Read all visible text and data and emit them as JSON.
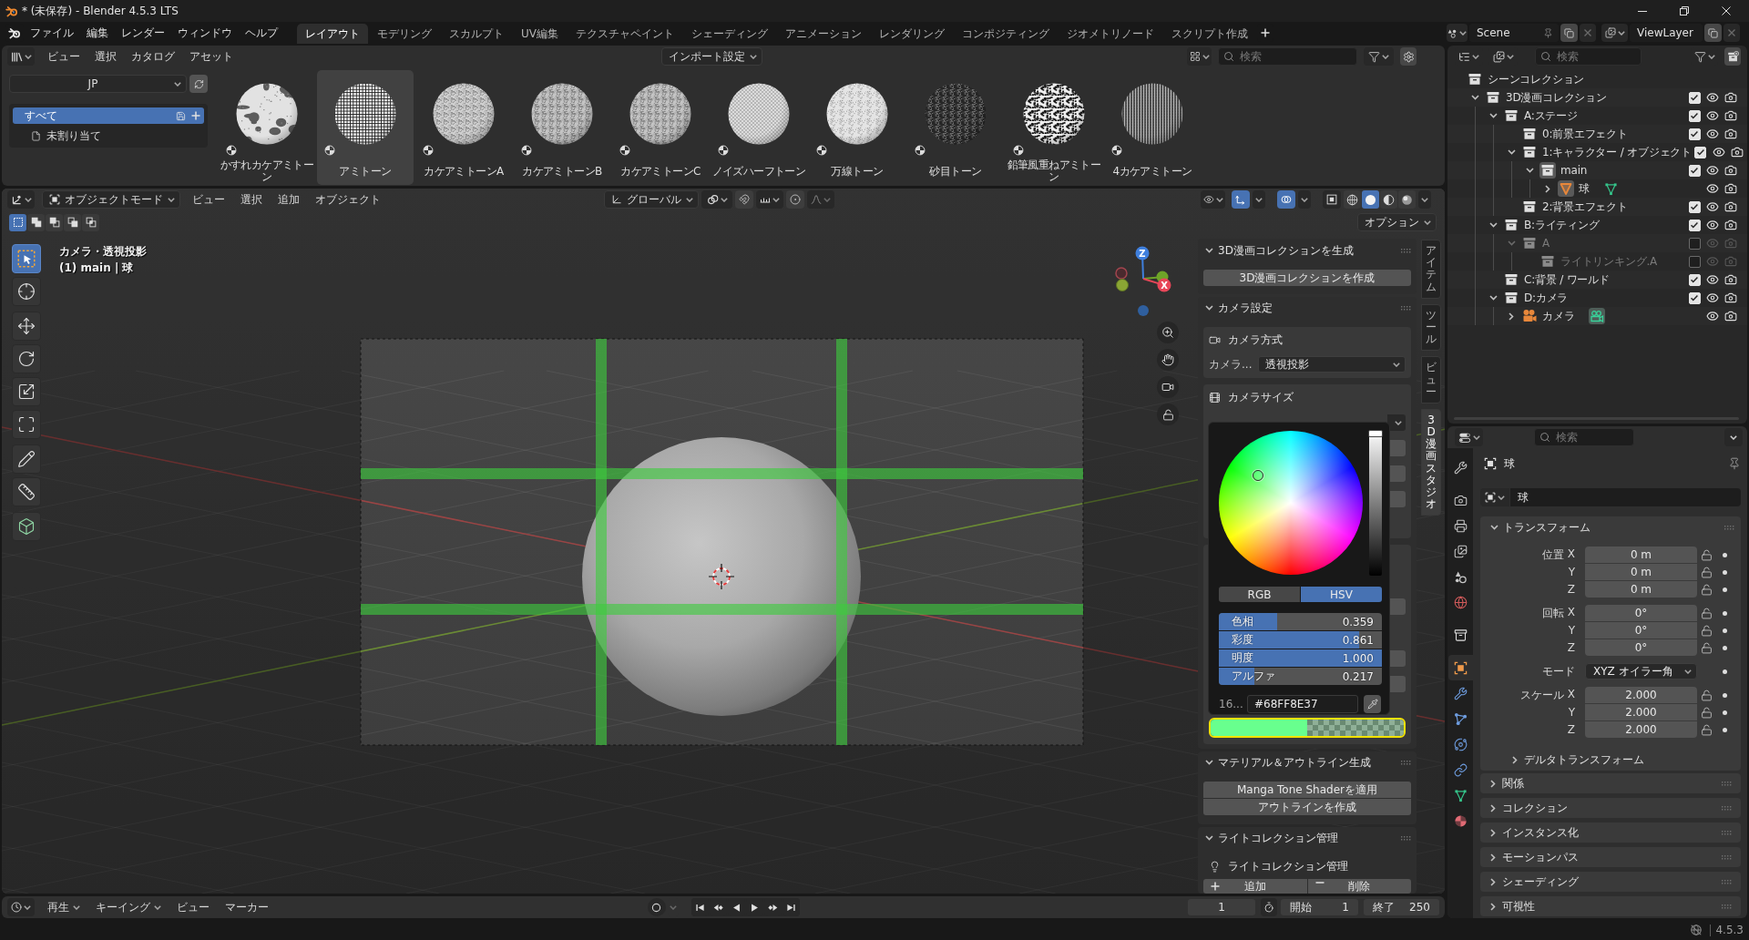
{
  "window": {
    "title": "* (未保存) - Blender 4.5.3 LTS"
  },
  "topbar": {
    "menus": [
      "ファイル",
      "編集",
      "レンダー",
      "ウィンドウ",
      "ヘルプ"
    ],
    "workspaces": [
      {
        "label": "レイアウト",
        "selected": true
      },
      {
        "label": "モデリング",
        "selected": false
      },
      {
        "label": "スカルプト",
        "selected": false
      },
      {
        "label": "UV編集",
        "selected": false
      },
      {
        "label": "テクスチャペイント",
        "selected": false
      },
      {
        "label": "シェーディング",
        "selected": false
      },
      {
        "label": "アニメーション",
        "selected": false
      },
      {
        "label": "レンダリング",
        "selected": false
      },
      {
        "label": "コンポジティング",
        "selected": false
      },
      {
        "label": "ジオメトリノード",
        "selected": false
      },
      {
        "label": "スクリプト作成",
        "selected": false
      }
    ],
    "scene": "Scene",
    "view_layer": "ViewLayer"
  },
  "asset_browser": {
    "menus": [
      "ビュー",
      "選択",
      "カタログ",
      "アセット"
    ],
    "import_setting": "インポート設定",
    "search": {
      "placeholder": "検索"
    },
    "library": "JP",
    "catalogs": [
      {
        "label": "すべて",
        "kind": "all",
        "selected": true
      },
      {
        "label": "未割り当て",
        "kind": "unassigned",
        "selected": false
      }
    ],
    "assets": [
      {
        "name": "かすれカケアミトーン",
        "kind": "blotch",
        "selected": false
      },
      {
        "name": "アミトーン",
        "kind": "grid",
        "selected": true
      },
      {
        "name": "カケアミトーンA",
        "kind": "crosshatch",
        "selected": false
      },
      {
        "name": "カケアミトーンB",
        "kind": "noise",
        "selected": false
      },
      {
        "name": "カケアミトーンC",
        "kind": "noise",
        "selected": false
      },
      {
        "name": "ノイズハーフトーン",
        "kind": "diagonal",
        "selected": false
      },
      {
        "name": "万線トーン",
        "kind": "speckle",
        "selected": false
      },
      {
        "name": "砂目トーン",
        "kind": "dark",
        "selected": false
      },
      {
        "name": "鉛筆風重ねアミトーン",
        "kind": "mottled",
        "selected": false
      },
      {
        "name": "4カケアミトーン",
        "kind": "stripes",
        "selected": false
      }
    ]
  },
  "viewport": {
    "mode": "オブジェクトモード",
    "menus": [
      "ビュー",
      "選択",
      "追加",
      "オブジェクト"
    ],
    "orientation": "グローバル",
    "shading": [
      {
        "kind": "wireframe",
        "selected": false
      },
      {
        "kind": "solid",
        "selected": true
      },
      {
        "kind": "material",
        "selected": false
      },
      {
        "kind": "rendered",
        "selected": false
      }
    ],
    "select_modes": [
      {
        "kind": "set",
        "selected": true
      },
      {
        "kind": "extend",
        "selected": false
      },
      {
        "kind": "subtract",
        "selected": false
      },
      {
        "kind": "invert",
        "selected": false
      },
      {
        "kind": "intersect",
        "selected": false
      }
    ],
    "options": "オプション",
    "overlay_text": {
      "view": "カメラ・透視投影",
      "object": "(1) main | 球"
    },
    "tool_groups": [
      [
        {
          "kind": "select_box",
          "selected": true
        },
        {
          "kind": "cursor",
          "selected": false
        }
      ],
      [
        {
          "kind": "move",
          "selected": false
        },
        {
          "kind": "rotate",
          "selected": false
        },
        {
          "kind": "scale",
          "selected": false
        },
        {
          "kind": "transform",
          "selected": false
        }
      ],
      [
        {
          "kind": "annotate",
          "selected": false
        },
        {
          "kind": "measure",
          "selected": false
        }
      ],
      [
        {
          "kind": "add_cube",
          "selected": false
        }
      ]
    ],
    "gizmo": {
      "z_label": "Z",
      "x_label": "X"
    },
    "sidebar": {
      "tabs": [
        {
          "label": "アイテム",
          "selected": false
        },
        {
          "label": "ツール",
          "selected": false
        },
        {
          "label": "ビュー",
          "selected": false
        },
        {
          "label": "3D漫画スタジオ",
          "selected": true
        }
      ],
      "generate_panel": {
        "title": "3D漫画コレクションを生成",
        "expanded": true,
        "button": "3D漫画コレクションを作成"
      },
      "camera_panel": {
        "title": "カメラ設定",
        "expanded": true,
        "method": {
          "title": "カメラ方式",
          "label": "カメラ...",
          "value": "透視投影"
        },
        "size": {
          "title": "カメラサイズ"
        }
      },
      "color_picker": {
        "modes": [
          {
            "label": "RGB",
            "selected": false
          },
          {
            "label": "HSV",
            "selected": true
          }
        ],
        "sliders": [
          {
            "label": "色相",
            "value": "0.359",
            "level": 0.359
          },
          {
            "label": "彩度",
            "value": "0.861",
            "level": 0.861
          },
          {
            "label": "明度",
            "value": "1.000",
            "level": 1.0
          },
          {
            "label": "アルファ",
            "value": "0.217",
            "level": 0.217
          }
        ],
        "hex_label": "16...",
        "hex": "#68FF8E37"
      },
      "color_swatch": {
        "active": true
      },
      "material_panel": {
        "title": "マテリアル＆アウトライン生成",
        "expanded": true,
        "buttons": [
          "Manga Tone Shaderを適用",
          "アウトラインを作成"
        ]
      },
      "light_panel": {
        "title": "ライトコレクション管理",
        "expanded": true,
        "subtitle": "ライトコレクション管理",
        "add": "追加",
        "remove": "削除"
      }
    }
  },
  "outliner": {
    "search": {
      "placeholder": "検索"
    },
    "tree": [
      {
        "label": "シーンコレクション",
        "kind": "scene_collection",
        "active": false,
        "disabled": false,
        "children": [
          {
            "label": "3D漫画コレクション",
            "kind": "collection",
            "expanded": true,
            "checked": true,
            "active": false,
            "disabled": false,
            "children": [
              {
                "label": "A:ステージ",
                "kind": "collection",
                "expanded": true,
                "checked": true,
                "active": false,
                "disabled": false,
                "children": [
                  {
                    "label": "0:前景エフェクト",
                    "kind": "collection",
                    "checked": true,
                    "active": false,
                    "disabled": false
                  },
                  {
                    "label": "1:キャラクター / オブジェクト",
                    "kind": "collection",
                    "expanded": true,
                    "checked": true,
                    "active": false,
                    "disabled": false,
                    "children": [
                      {
                        "label": "main",
                        "kind": "collection",
                        "expanded": true,
                        "checked": true,
                        "active": true,
                        "disabled": false,
                        "children": [
                          {
                            "label": "球",
                            "kind": "mesh_object",
                            "expanded": false,
                            "active": true,
                            "disabled": false
                          }
                        ]
                      }
                    ]
                  },
                  {
                    "label": "2:背景エフェクト",
                    "kind": "collection",
                    "checked": true,
                    "active": false,
                    "disabled": false
                  }
                ]
              },
              {
                "label": "B:ライティング",
                "kind": "collection",
                "expanded": true,
                "checked": true,
                "active": false,
                "disabled": false,
                "children": [
                  {
                    "label": "A",
                    "kind": "collection",
                    "expanded": true,
                    "checked": false,
                    "active": false,
                    "disabled": true,
                    "children": [
                      {
                        "label": "ライトリンキング.A",
                        "kind": "collection",
                        "checked": false,
                        "active": false,
                        "disabled": true
                      }
                    ]
                  }
                ]
              },
              {
                "label": "C:背景 / ワールド",
                "kind": "collection",
                "checked": true,
                "active": false,
                "disabled": false
              },
              {
                "label": "D:カメラ",
                "kind": "collection",
                "expanded": true,
                "checked": true,
                "active": false,
                "disabled": false,
                "children": [
                  {
                    "label": "カメラ",
                    "kind": "camera_object",
                    "expanded": false,
                    "active": false,
                    "disabled": false
                  }
                ]
              }
            ]
          }
        ]
      }
    ]
  },
  "properties": {
    "search": {
      "placeholder": "検索"
    },
    "tab_groups": [
      [
        {
          "kind": "tool",
          "selected": false
        }
      ],
      [
        {
          "kind": "render",
          "selected": false
        },
        {
          "kind": "output",
          "selected": false
        },
        {
          "kind": "view_layer",
          "selected": false
        },
        {
          "kind": "scene",
          "selected": false
        },
        {
          "kind": "world",
          "selected": false
        }
      ],
      [
        {
          "kind": "collection",
          "selected": false
        }
      ],
      [
        {
          "kind": "object",
          "selected": true
        },
        {
          "kind": "modifiers",
          "selected": false
        },
        {
          "kind": "particles",
          "selected": false
        },
        {
          "kind": "physics",
          "selected": false
        },
        {
          "kind": "constraints",
          "selected": false
        },
        {
          "kind": "data",
          "selected": false
        },
        {
          "kind": "material",
          "selected": false
        }
      ]
    ],
    "object_name": "球",
    "name_field": "球",
    "transform": {
      "title": "トランスフォーム",
      "expanded": true,
      "fields": [
        {
          "kind": "vector",
          "label": "位置",
          "rows": [
            {
              "axis": "X",
              "value": "0 m",
              "locked": false
            },
            {
              "axis": "Y",
              "value": "0 m",
              "locked": false
            },
            {
              "axis": "Z",
              "value": "0 m",
              "locked": false
            }
          ]
        },
        {
          "kind": "vector",
          "label": "回転",
          "rows": [
            {
              "axis": "X",
              "value": "0°",
              "locked": false
            },
            {
              "axis": "Y",
              "value": "0°",
              "locked": false
            },
            {
              "axis": "Z",
              "value": "0°",
              "locked": false
            }
          ]
        },
        {
          "kind": "enum",
          "label": "モード",
          "value": "XYZ オイラー角"
        },
        {
          "kind": "vector",
          "label": "スケール",
          "rows": [
            {
              "axis": "X",
              "value": "2.000",
              "locked": false
            },
            {
              "axis": "Y",
              "value": "2.000",
              "locked": false
            },
            {
              "axis": "Z",
              "value": "2.000",
              "locked": false
            }
          ]
        }
      ],
      "delta": {
        "title": "デルタトランスフォーム",
        "expanded": false
      }
    },
    "panels": [
      {
        "title": "関係",
        "expanded": false
      },
      {
        "title": "コレクション",
        "expanded": false
      },
      {
        "title": "インスタンス化",
        "expanded": false
      },
      {
        "title": "モーションパス",
        "expanded": false
      },
      {
        "title": "シェーディング",
        "expanded": false
      },
      {
        "title": "可視性",
        "expanded": false
      }
    ]
  },
  "timeline": {
    "menus": [
      {
        "label": "再生",
        "kind": "dropdown"
      },
      {
        "label": "キーイング",
        "kind": "dropdown"
      },
      {
        "label": "ビュー",
        "kind": "menu"
      },
      {
        "label": "マーカー",
        "kind": "menu"
      }
    ],
    "current_frame": "1",
    "start_label": "開始",
    "start": "1",
    "end_label": "終了",
    "end": "250"
  },
  "status_bar": {
    "version": "4.5.3"
  }
}
